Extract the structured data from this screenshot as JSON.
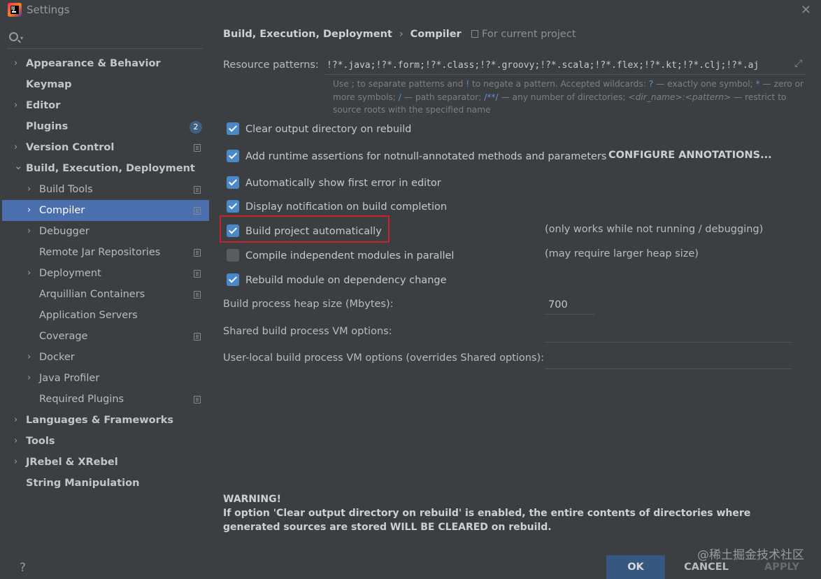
{
  "window": {
    "title": "Settings",
    "close_glyph": "✕"
  },
  "sidebar": {
    "search_placeholder": "",
    "items": [
      {
        "label": "Appearance & Behavior",
        "level": 0,
        "expandable": true
      },
      {
        "label": "Keymap",
        "level": 0,
        "expandable": false
      },
      {
        "label": "Editor",
        "level": 0,
        "expandable": true
      },
      {
        "label": "Plugins",
        "level": 0,
        "expandable": false,
        "badge": "2"
      },
      {
        "label": "Version Control",
        "level": 0,
        "expandable": true,
        "project_icon": true
      },
      {
        "label": "Build, Execution, Deployment",
        "level": 0,
        "expandable": true,
        "expanded": true
      },
      {
        "label": "Build Tools",
        "level": 1,
        "expandable": true,
        "project_icon": true
      },
      {
        "label": "Compiler",
        "level": 1,
        "expandable": true,
        "project_icon": true,
        "selected": true
      },
      {
        "label": "Debugger",
        "level": 1,
        "expandable": true
      },
      {
        "label": "Remote Jar Repositories",
        "level": 1,
        "expandable": false,
        "project_icon": true
      },
      {
        "label": "Deployment",
        "level": 1,
        "expandable": true,
        "project_icon": true
      },
      {
        "label": "Arquillian Containers",
        "level": 1,
        "expandable": false,
        "project_icon": true
      },
      {
        "label": "Application Servers",
        "level": 1,
        "expandable": false
      },
      {
        "label": "Coverage",
        "level": 1,
        "expandable": false,
        "project_icon": true
      },
      {
        "label": "Docker",
        "level": 1,
        "expandable": true
      },
      {
        "label": "Java Profiler",
        "level": 1,
        "expandable": true
      },
      {
        "label": "Required Plugins",
        "level": 1,
        "expandable": false,
        "project_icon": true
      },
      {
        "label": "Languages & Frameworks",
        "level": 0,
        "expandable": true
      },
      {
        "label": "Tools",
        "level": 0,
        "expandable": true
      },
      {
        "label": "JRebel & XRebel",
        "level": 0,
        "expandable": true
      },
      {
        "label": "String Manipulation",
        "level": 0,
        "expandable": false
      }
    ],
    "help_label": "?"
  },
  "main": {
    "breadcrumb": {
      "parent": "Build, Execution, Deployment",
      "separator": "›",
      "current": "Compiler"
    },
    "for_current_project": "For current project",
    "resource_patterns": {
      "label": "Resource patterns:",
      "value": "!?*.java;!?*.form;!?*.class;!?*.groovy;!?*.scala;!?*.flex;!?*.kt;!?*.clj;!?*.aj",
      "hint_parts": {
        "p1": "Use ; to separate patterns and ",
        "bang": "!",
        "p2": " to negate a pattern. Accepted wildcards: ",
        "q": "?",
        "p3": " — exactly one symbol; ",
        "star": "*",
        "p4": " — zero or more symbols; ",
        "slash": "/",
        "p5": " — path separator; ",
        "dstar": "/**/",
        "p6": " — any number of directories; ",
        "dirname": "<dir_name>:<pattern>",
        "p7": " — restrict to source roots with the specified name"
      }
    },
    "options": [
      {
        "label": "Clear output directory on rebuild",
        "checked": true
      },
      {
        "label": "Add runtime assertions for notnull-annotated methods and parameters",
        "checked": true
      },
      {
        "label": "Automatically show first error in editor",
        "checked": true
      },
      {
        "label": "Display notification on build completion",
        "checked": true
      },
      {
        "label": "Build project automatically",
        "checked": true,
        "note": "(only works while not running / debugging)"
      },
      {
        "label": "Compile independent modules in parallel",
        "checked": false,
        "note": "(may require larger heap size)"
      },
      {
        "label": "Rebuild module on dependency change",
        "checked": true
      }
    ],
    "configure_annotations": "CONFIGURE ANNOTATIONS...",
    "heap_size": {
      "label": "Build process heap size (Mbytes):",
      "value": "700"
    },
    "shared_vm": {
      "label": "Shared build process VM options:",
      "value": ""
    },
    "user_local_vm": {
      "label": "User-local build process VM options (overrides Shared options):",
      "value": ""
    },
    "warning": {
      "title": "WARNING!",
      "text": "If option 'Clear output directory on rebuild' is enabled, the entire contents of directories where generated sources are stored WILL BE CLEARED on rebuild."
    }
  },
  "buttons": {
    "ok": "OK",
    "cancel": "CANCEL",
    "apply": "APPLY"
  },
  "watermark": "@稀土掘金技术社区",
  "colors": {
    "background": "#3c3f41",
    "selection": "#4b6eaf",
    "checkbox": "#4a88c7",
    "ok_button": "#365880",
    "highlight_box": "#c8232c"
  }
}
